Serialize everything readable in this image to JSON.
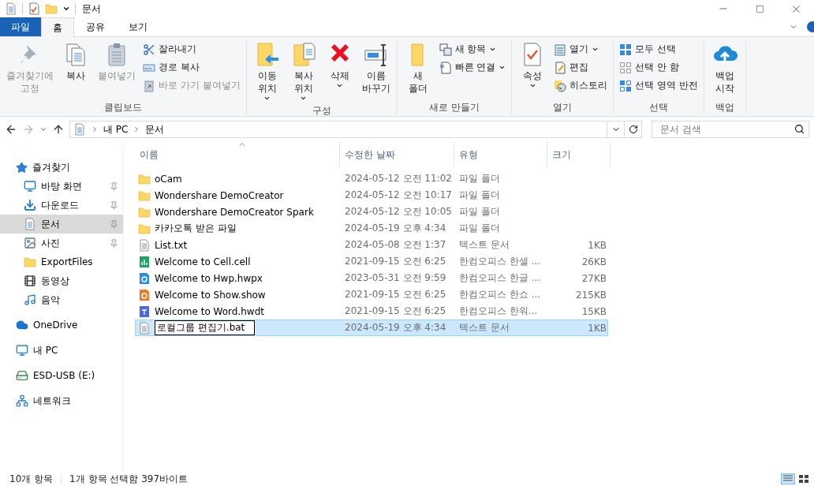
{
  "window": {
    "title": "문서"
  },
  "tabs": [
    {
      "label": "파일",
      "kind": "file",
      "selected": false
    },
    {
      "label": "홈",
      "kind": "tab",
      "selected": true
    },
    {
      "label": "공유",
      "kind": "tab",
      "selected": false
    },
    {
      "label": "보기",
      "kind": "tab",
      "selected": false
    }
  ],
  "ribbon": {
    "groups": [
      {
        "label": "클립보드",
        "items": [
          {
            "kind": "large",
            "label": "즐겨찾기에\n고정",
            "disabled": true,
            "dropdown": false
          },
          {
            "kind": "large",
            "label": "복사",
            "disabled": false,
            "dropdown": false
          },
          {
            "kind": "large",
            "label": "붙여넣기",
            "disabled": true,
            "dropdown": false
          },
          {
            "kind": "stack",
            "items": [
              {
                "label": "잘라내기",
                "disabled": false,
                "dropdown": false
              },
              {
                "label": "경로 복사",
                "disabled": false,
                "dropdown": false
              },
              {
                "label": "바로 가기 붙여넣기",
                "disabled": true,
                "dropdown": false
              }
            ]
          }
        ]
      },
      {
        "label": "구성",
        "items": [
          {
            "kind": "large",
            "label": "이동\n위치",
            "disabled": false,
            "dropdown": true
          },
          {
            "kind": "large",
            "label": "복사\n위치",
            "disabled": false,
            "dropdown": true
          },
          {
            "kind": "large",
            "label": "삭제",
            "disabled": false,
            "dropdown": true
          },
          {
            "kind": "large",
            "label": "이름\n바꾸기",
            "disabled": false,
            "dropdown": false
          }
        ]
      },
      {
        "label": "새로 만들기",
        "items": [
          {
            "kind": "large",
            "label": "새\n폴더",
            "disabled": false,
            "dropdown": false
          },
          {
            "kind": "stack",
            "items": [
              {
                "label": "새 항목",
                "disabled": false,
                "dropdown": true
              },
              {
                "label": "빠른 연결",
                "disabled": false,
                "dropdown": true
              }
            ]
          }
        ]
      },
      {
        "label": "열기",
        "items": [
          {
            "kind": "large",
            "label": "속성",
            "disabled": false,
            "dropdown": true
          },
          {
            "kind": "stack",
            "items": [
              {
                "label": "열기",
                "disabled": false,
                "dropdown": true
              },
              {
                "label": "편집",
                "disabled": false,
                "dropdown": false
              },
              {
                "label": "히스토리",
                "disabled": false,
                "dropdown": false
              }
            ]
          }
        ]
      },
      {
        "label": "선택",
        "items": [
          {
            "kind": "stack",
            "items": [
              {
                "label": "모두 선택",
                "disabled": false,
                "dropdown": false
              },
              {
                "label": "선택 안 함",
                "disabled": false,
                "dropdown": false
              },
              {
                "label": "선택 영역 반전",
                "disabled": false,
                "dropdown": false
              }
            ]
          }
        ]
      },
      {
        "label": "백업",
        "items": [
          {
            "kind": "large",
            "label": "백업\n시작",
            "disabled": false,
            "dropdown": false
          }
        ]
      }
    ]
  },
  "address": {
    "crumbs": [
      "내 PC",
      "문서"
    ]
  },
  "search": {
    "placeholder": "문서 검색"
  },
  "sidebar": {
    "items": [
      {
        "kind": "star",
        "label": "즐겨찾기",
        "selected": false,
        "pinned": false,
        "children": [
          {
            "kind": "desktop",
            "label": "바탕 화면",
            "selected": false,
            "pinned": true
          },
          {
            "kind": "download",
            "label": "다운로드",
            "selected": false,
            "pinned": true
          },
          {
            "kind": "documents",
            "label": "문서",
            "selected": true,
            "pinned": true
          },
          {
            "kind": "pictures",
            "label": "사진",
            "selected": false,
            "pinned": true
          },
          {
            "kind": "folder",
            "label": "ExportFiles",
            "selected": false,
            "pinned": false
          },
          {
            "kind": "video",
            "label": "동영상",
            "selected": false,
            "pinned": false
          },
          {
            "kind": "music",
            "label": "음악",
            "selected": false,
            "pinned": false
          }
        ]
      },
      {
        "kind": "cloud",
        "label": "OneDrive",
        "selected": false,
        "pinned": false
      },
      {
        "kind": "pc",
        "label": "내 PC",
        "selected": false,
        "pinned": false
      },
      {
        "kind": "usb",
        "label": "ESD-USB (E:)",
        "selected": false,
        "pinned": false
      },
      {
        "kind": "network",
        "label": "네트워크",
        "selected": false,
        "pinned": false
      }
    ]
  },
  "table": {
    "columns": [
      {
        "label": "이름",
        "sorted": true
      },
      {
        "label": "수정한 날짜",
        "sorted": false
      },
      {
        "label": "유형",
        "sorted": false
      },
      {
        "label": "크기",
        "sorted": false
      }
    ],
    "rows": [
      {
        "kind": "folder",
        "name": "oCam",
        "date": "2024-05-12 오전 11:02",
        "type": "파일 폴더",
        "selected": false,
        "renaming": false
      },
      {
        "kind": "folder",
        "name": "Wondershare DemoCreator",
        "date": "2024-05-12 오전 10:17",
        "type": "파일 폴더",
        "selected": false,
        "renaming": false
      },
      {
        "kind": "folder",
        "name": "Wondershare DemoCreator Spark",
        "date": "2024-05-12 오전 10:05",
        "type": "파일 폴더",
        "selected": false,
        "renaming": false
      },
      {
        "kind": "folder",
        "name": "카카오톡 받은 파일",
        "date": "2024-05-19 오후 4:34",
        "type": "파일 폴더",
        "selected": false,
        "renaming": false
      },
      {
        "kind": "text",
        "name": "List.txt",
        "date": "2024-05-08 오전 1:37",
        "type": "텍스트 문서",
        "size": "1KB",
        "selected": false,
        "renaming": false
      },
      {
        "kind": "cell",
        "name": "Welcome to Cell.cell",
        "date": "2021-09-15 오전 6:25",
        "type": "한컴오피스 한셀 ...",
        "size": "26KB",
        "selected": false,
        "renaming": false
      },
      {
        "kind": "hwp",
        "name": "Welcome to Hwp.hwpx",
        "date": "2023-05-31 오전 9:59",
        "type": "한컴오피스 한글 ...",
        "size": "27KB",
        "selected": false,
        "renaming": false
      },
      {
        "kind": "show",
        "name": "Welcome to Show.show",
        "date": "2021-09-15 오전 6:25",
        "type": "한컴오피스 한쇼 ...",
        "size": "215KB",
        "selected": false,
        "renaming": false
      },
      {
        "kind": "word",
        "name": "Welcome to Word.hwdt",
        "date": "2021-09-15 오전 6:25",
        "type": "한컴오피스 한워...",
        "size": "15KB",
        "selected": false,
        "renaming": false
      },
      {
        "kind": "text",
        "name": "로컬그룹 편집기.bat",
        "date": "2024-05-19 오후 4:34",
        "type": "텍스트 문서",
        "size": "1KB",
        "selected": true,
        "renaming": true
      }
    ]
  },
  "status_bar": {
    "items": [
      "10개 항목",
      "1개 항목 선택함 397바이트"
    ],
    "views": [
      {
        "kind": "details",
        "selected": true
      },
      {
        "kind": "tiles",
        "selected": false
      }
    ]
  }
}
